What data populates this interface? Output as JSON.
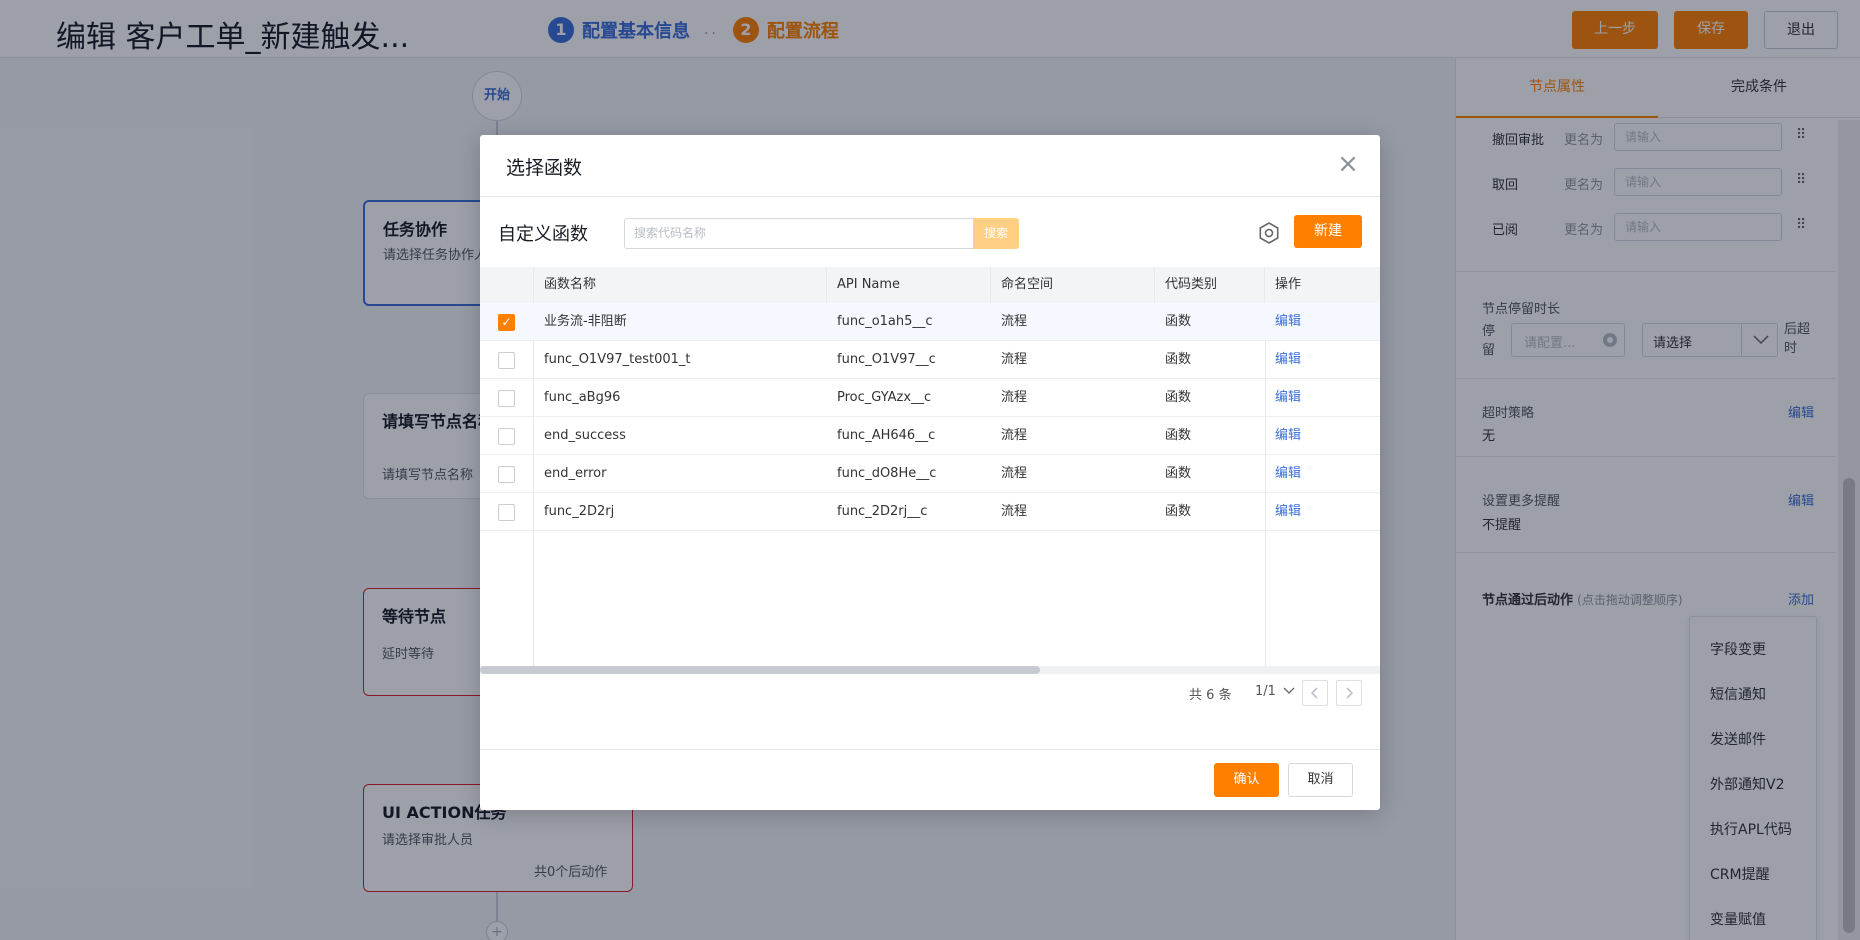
{
  "header": {
    "title": "编辑 客户工单_新建触发...",
    "steps": [
      {
        "num": "1",
        "label": "配置基本信息",
        "color": "#3a6fd8"
      },
      {
        "num": "2",
        "label": "配置流程",
        "color": "#ff8000"
      }
    ],
    "step_dots": "..",
    "prev_label": "上一步",
    "save_label": "保存",
    "exit_label": "退出"
  },
  "colors": {
    "accent": "#ff8000",
    "link": "#3a6fd8",
    "node_active": "#3a6fd8",
    "node_error": "#e02020"
  },
  "canvas": {
    "start_label": "开始",
    "plus_label": "+",
    "nodes": [
      {
        "title": "任务协作",
        "desc": "请选择任务协作人员",
        "footer": ""
      },
      {
        "title": "请填写节点名称",
        "desc": "请填写节点名称",
        "footer": ""
      },
      {
        "title": "等待节点",
        "desc": "延时等待",
        "footer": ""
      },
      {
        "title": "UI ACTION任务",
        "desc": "请选择审批人员",
        "footer": "共0个后动作"
      }
    ]
  },
  "right_panel": {
    "tabs": [
      "节点属性",
      "完成条件"
    ],
    "active_tab": "节点属性",
    "rename_rows": [
      {
        "label": "撤回审批",
        "rename": "更名为",
        "placeholder": "请输入"
      },
      {
        "label": "取回",
        "rename": "更名为",
        "placeholder": "请输入"
      },
      {
        "label": "已阅",
        "rename": "更名为",
        "placeholder": "请输入"
      }
    ],
    "drag_icon": "⠿",
    "stay": {
      "title": "节点停留时长",
      "stay_label": "停留",
      "config_placeholder": "请配置...",
      "select_value": "请选择",
      "timeout_label": "后超时"
    },
    "timeout_strategy": {
      "title": "超时策略",
      "edit": "编辑",
      "value": "无"
    },
    "reminder": {
      "title": "设置更多提醒",
      "edit": "编辑",
      "value": "不提醒"
    },
    "post_actions": {
      "title": "节点通过后动作",
      "hint": "(点击拖动调整顺序)",
      "add": "添加"
    },
    "action_menu": [
      "字段变更",
      "短信通知",
      "发送邮件",
      "外部通知V2",
      "执行APL代码",
      "CRM提醒",
      "变量赋值"
    ]
  },
  "modal": {
    "title": "选择函数",
    "close_icon": "×",
    "label": "自定义函数",
    "search_placeholder": "搜索代码名称",
    "search_button": "搜索",
    "new_button": "新建",
    "columns": [
      "函数名称",
      "API Name",
      "命名空间",
      "代码类别",
      "操作"
    ],
    "rows": [
      {
        "checked": true,
        "name": "业务流-非阻断",
        "api": "func_o1ah5__c",
        "namespace": "流程",
        "category": "函数",
        "action": "编辑"
      },
      {
        "checked": false,
        "name": "func_O1V97_test001_t",
        "api": "func_O1V97__c",
        "namespace": "流程",
        "category": "函数",
        "action": "编辑"
      },
      {
        "checked": false,
        "name": "func_aBg96",
        "api": "Proc_GYAzx__c",
        "namespace": "流程",
        "category": "函数",
        "action": "编辑"
      },
      {
        "checked": false,
        "name": "end_success",
        "api": "func_AH646__c",
        "namespace": "流程",
        "category": "函数",
        "action": "编辑"
      },
      {
        "checked": false,
        "name": "end_error",
        "api": "func_dO8He__c",
        "namespace": "流程",
        "category": "函数",
        "action": "编辑"
      },
      {
        "checked": false,
        "name": "func_2D2rj",
        "api": "func_2D2rj__c",
        "namespace": "流程",
        "category": "函数",
        "action": "编辑"
      }
    ],
    "pager": {
      "total": "共 6 条",
      "page": "1/1"
    },
    "confirm": "确认",
    "cancel": "取消"
  }
}
